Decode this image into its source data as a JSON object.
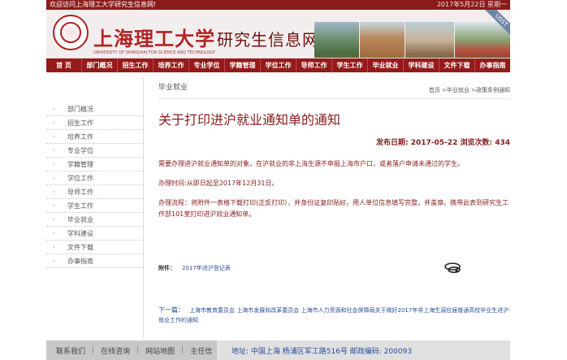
{
  "topbar": {
    "welcome": "欢迎访问上海理工大学研究生信息网!",
    "date": "2017年5月22日  星期一"
  },
  "banner": {
    "title_main": "上海理工大学",
    "title_sub": "研究生信息网",
    "title_en": "UNIVERSITY OF SHANGHAI FOR SCIENCE AND TECHNOLOGY",
    "corner_tag": "USST"
  },
  "nav": {
    "items": [
      "首 页",
      "部门概况",
      "招生工作",
      "培养工作",
      "专业学位",
      "学籍管理",
      "学位工作",
      "导师工作",
      "学生工作",
      "毕业就业",
      "学科建设",
      "文件下载",
      "办事指南"
    ]
  },
  "sidebar": {
    "items": [
      "部门概况",
      "招生工作",
      "培养工作",
      "专业学位",
      "学籍管理",
      "学位工作",
      "导师工作",
      "学生工作",
      "毕业就业",
      "学科建设",
      "文件下载",
      "办事指南"
    ]
  },
  "main": {
    "section_name": "毕业就业",
    "breadcrumb": "首页  >毕业就业  >政策条例通知",
    "title": "关于打印进沪就业通知单的通知",
    "meta": "发布日期: 2017-05-22  浏览次数: 434",
    "paragraphs": [
      "需要办理进沪就业通知单的对象，在沪就业的非上海生源不申报上海市户口，或者落户申请未通过的学生。",
      "办理时间:从即日起至2017年12月31日。",
      "办理流程：将附件一表格下载打印(正反打印），并身份证复印贴好。用人单位信息填写完整，并盖章。携带此表到研究生工作部101室打印进沪就业通知单。"
    ],
    "attachment_label": "附件：",
    "attachment_link": "2017年进沪登记表",
    "next_label": "下一篇：",
    "next_text": "上海市教育委员会 上海市发展和改革委员会 上海市人力资源和社会保障局关于做好2017年非上海生源应届普通高校毕业生进沪就业工作的通知"
  },
  "footer": {
    "links": [
      "联系我们",
      "在线咨询",
      "网站地图",
      "主任信"
    ],
    "address": "地址: 中国上海 杨浦区军工路516号  邮政编码: 200093"
  },
  "colors": {
    "brand": "#951a1a",
    "title": "#8b1a1a",
    "link": "#2a4f9a"
  }
}
